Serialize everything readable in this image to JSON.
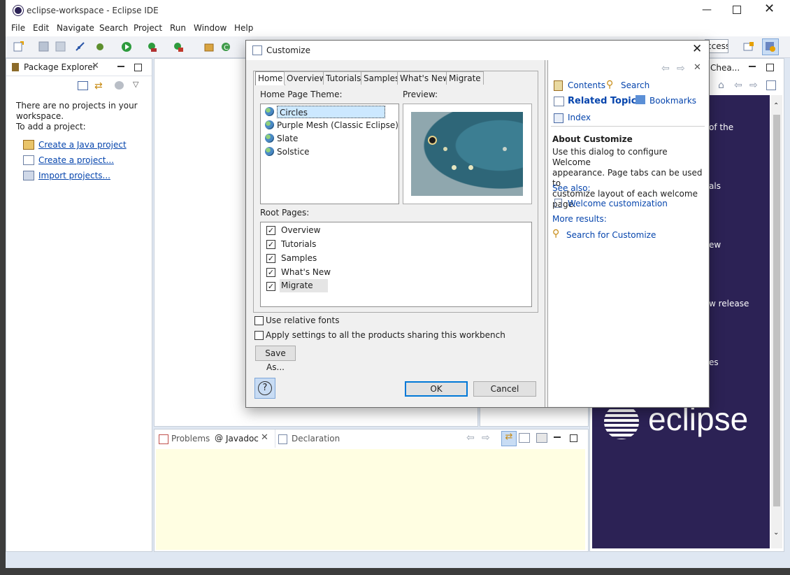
{
  "window": {
    "title": "eclipse-workspace - Eclipse IDE"
  },
  "menu": [
    "File",
    "Edit",
    "Navigate",
    "Search",
    "Project",
    "Run",
    "Window",
    "Help"
  ],
  "toolbar": {
    "quick_access_fragment": "ccess"
  },
  "package_explorer": {
    "tab_label": "Package Explorer",
    "message_line1": "There are no projects in your",
    "message_line2": "workspace.",
    "message_line3": "To add a project:",
    "links": [
      "Create a Java project",
      "Create a project...",
      "Import projects..."
    ]
  },
  "bottom_panel": {
    "tabs": [
      "Problems",
      "Javadoc",
      "Declaration"
    ]
  },
  "cheatsheet": {
    "tab_label": "Chea...",
    "fragments": [
      "of the",
      "als",
      "ew",
      "w release",
      "es"
    ],
    "logo_text": "eclipse"
  },
  "dialog": {
    "title": "Customize",
    "tabs": [
      "Home",
      "Overview",
      "Tutorials",
      "Samples",
      "What's New",
      "Migrate"
    ],
    "theme_label": "Home Page Theme:",
    "preview_label": "Preview:",
    "themes": [
      "Circles",
      "Purple Mesh (Classic Eclipse)",
      "Slate",
      "Solstice"
    ],
    "root_pages_label": "Root Pages:",
    "root_pages": [
      "Overview",
      "Tutorials",
      "Samples",
      "What's New",
      "Migrate"
    ],
    "use_relative_fonts": "Use relative fonts",
    "apply_settings": "Apply settings to all the products sharing this workbench",
    "save_as": "Save As...",
    "ok": "OK",
    "cancel": "Cancel",
    "help": {
      "contents": "Contents",
      "search": "Search",
      "related_topics": "Related Topics",
      "bookmarks": "Bookmarks",
      "index": "Index",
      "about_title": "About Customize",
      "about_line1": "Use this dialog to configure Welcome",
      "about_line2": "appearance. Page tabs can be used to",
      "about_line3": "customize layout of each welcome page.",
      "see_also": "See also:",
      "welcome_customization": "Welcome customization",
      "more_results": "More results:",
      "search_for": "Search for Customize"
    }
  }
}
